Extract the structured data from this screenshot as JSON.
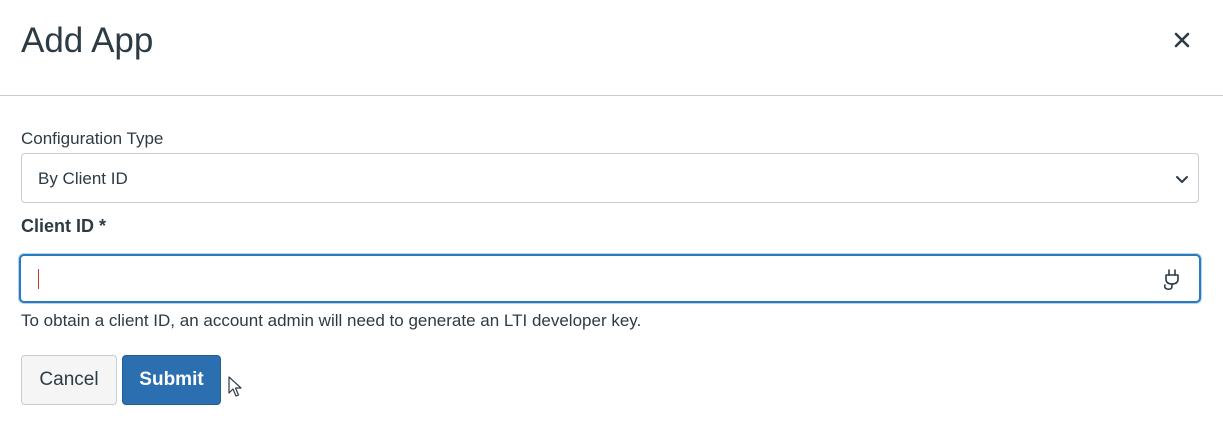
{
  "dialog": {
    "title": "Add App",
    "close_icon": "close-icon"
  },
  "form": {
    "config_type": {
      "label": "Configuration Type",
      "selected": "By Client ID",
      "icon": "chevron-down-icon"
    },
    "client_id": {
      "label": "Client ID *",
      "value": "",
      "icon": "plug-icon",
      "help": "To obtain a client ID, an account admin will need to generate an LTI developer key."
    }
  },
  "actions": {
    "cancel_label": "Cancel",
    "submit_label": "Submit"
  },
  "colors": {
    "text": "#2d3b45",
    "submit_bg": "#2b6fb0",
    "focus_border": "#2b7abc",
    "divider": "#c7cdd1"
  }
}
